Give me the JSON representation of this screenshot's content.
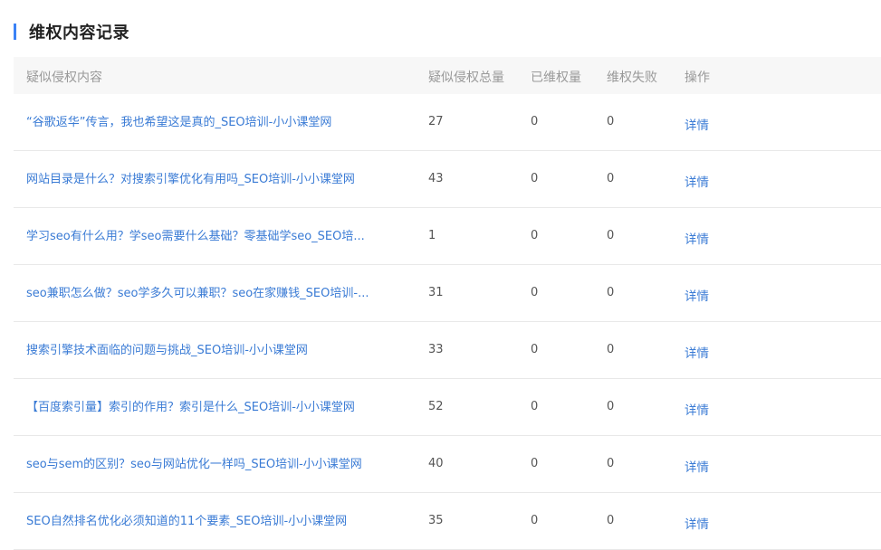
{
  "section": {
    "title": "维权内容记录",
    "accent_color": "#3b82f6"
  },
  "table": {
    "headers": {
      "content": "疑似侵权内容",
      "total": "疑似侵权总量",
      "protected": "已维权量",
      "failed": "维权失败",
      "action": "操作"
    },
    "rows": [
      {
        "title": "“谷歌返华”传言，我也希望这是真的_SEO培训-小小课堂网",
        "total": "27",
        "protected": "0",
        "failed": "0",
        "action": "详情"
      },
      {
        "title": "网站目录是什么？对搜索引擎优化有用吗_SEO培训-小小课堂网",
        "total": "43",
        "protected": "0",
        "failed": "0",
        "action": "详情"
      },
      {
        "title": "学习seo有什么用？学seo需要什么基础？零基础学seo_SEO培...",
        "total": "1",
        "protected": "0",
        "failed": "0",
        "action": "详情"
      },
      {
        "title": "seo兼职怎么做？seo学多久可以兼职？seo在家赚钱_SEO培训-...",
        "total": "31",
        "protected": "0",
        "failed": "0",
        "action": "详情"
      },
      {
        "title": "搜索引擎技术面临的问题与挑战_SEO培训-小小课堂网",
        "total": "33",
        "protected": "0",
        "failed": "0",
        "action": "详情"
      },
      {
        "title": "【百度索引量】索引的作用？索引是什么_SEO培训-小小课堂网",
        "total": "52",
        "protected": "0",
        "failed": "0",
        "action": "详情"
      },
      {
        "title": "seo与sem的区别？seo与网站优化一样吗_SEO培训-小小课堂网",
        "total": "40",
        "protected": "0",
        "failed": "0",
        "action": "详情"
      },
      {
        "title": "SEO自然排名优化必须知道的11个要素_SEO培训-小小课堂网",
        "total": "35",
        "protected": "0",
        "failed": "0",
        "action": "详情"
      }
    ]
  },
  "colors": {
    "link": "#3a7bd5",
    "header_bg": "#f7f7f7",
    "header_text": "#999999"
  }
}
